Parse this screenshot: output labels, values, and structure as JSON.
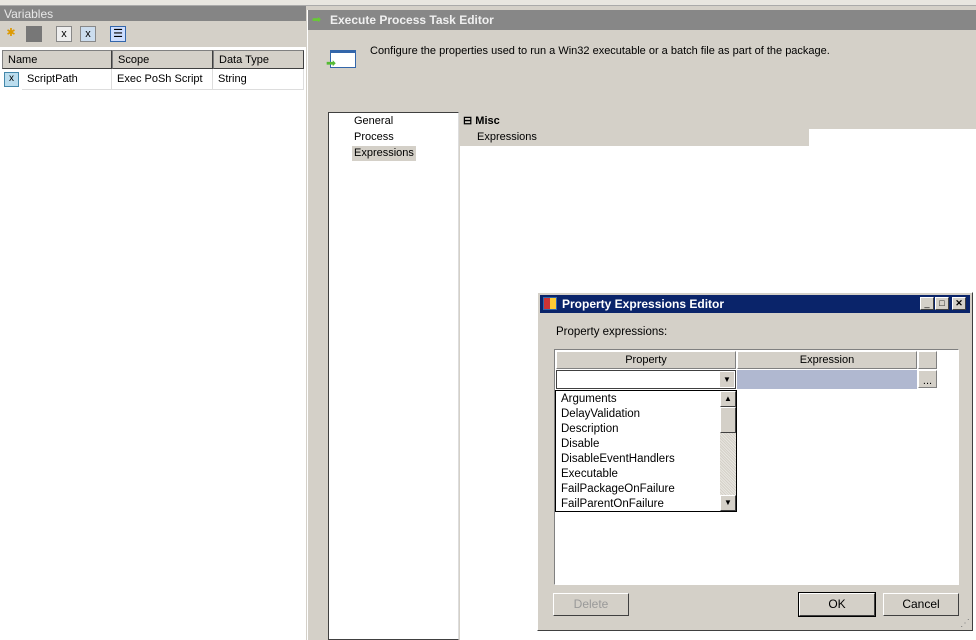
{
  "variables": {
    "title": "Variables",
    "columns": [
      "Name",
      "Scope",
      "Data Type"
    ],
    "rows": [
      {
        "name": "ScriptPath",
        "scope": "Exec PoSh Script",
        "type": "String"
      }
    ]
  },
  "editor": {
    "title": "Execute Process Task Editor",
    "description": "Configure the properties used to run a Win32 executable or a batch file as part of the package.",
    "nav": [
      "General",
      "Process",
      "Expressions"
    ],
    "selected_nav": "Expressions",
    "category": "Misc",
    "property": "Expressions",
    "expand_glyph": "⊟"
  },
  "dialog": {
    "title": "Property Expressions Editor",
    "label": "Property expressions:",
    "columns": [
      "Property",
      "Expression"
    ],
    "ellipsis": "...",
    "combo_value": "",
    "options": [
      "Arguments",
      "DelayValidation",
      "Description",
      "Disable",
      "DisableEventHandlers",
      "Executable",
      "FailPackageOnFailure",
      "FailParentOnFailure"
    ],
    "buttons": {
      "delete": "Delete",
      "ok": "OK",
      "cancel": "Cancel"
    }
  },
  "colors": {
    "titlebar": "#0a246a",
    "selection": "#b0b8d0"
  }
}
